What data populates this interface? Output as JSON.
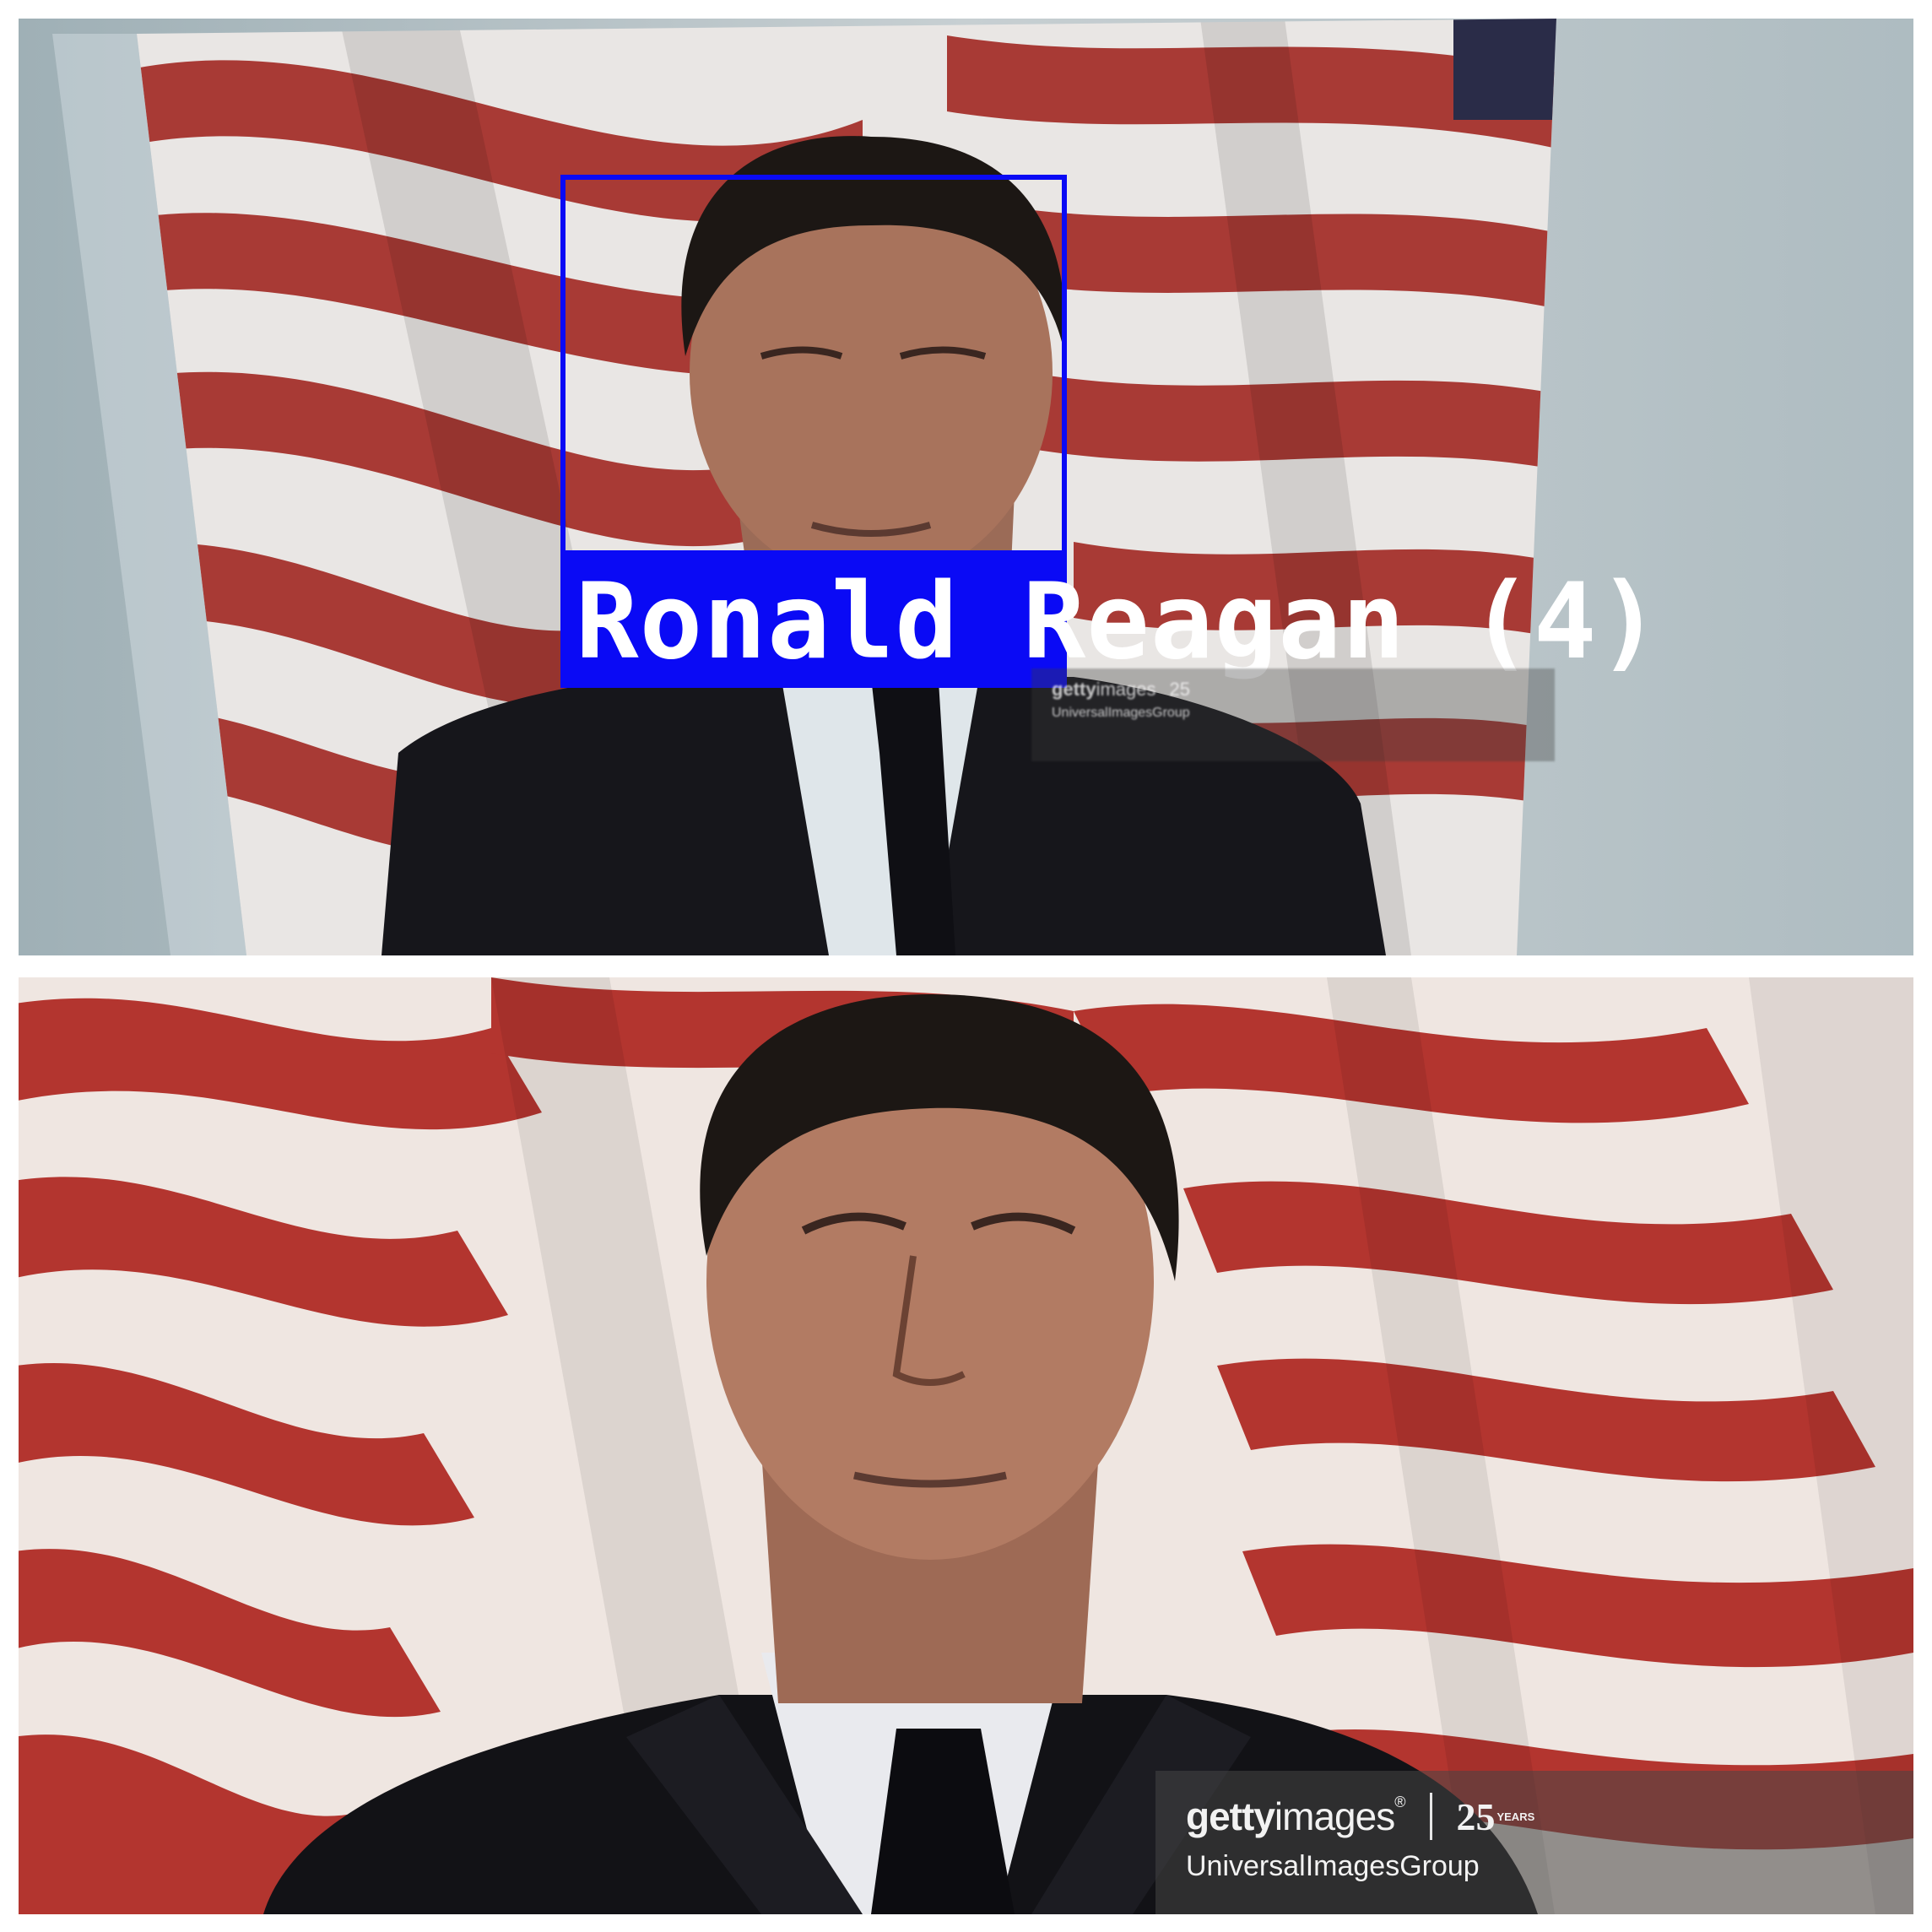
{
  "top_panel": {
    "detection_label": "Ronald Reagan (4)",
    "box_color": "#0a0af5",
    "watermark": {
      "brand_bold": "getty",
      "brand_light": "images",
      "years": "25",
      "credit": "UniversalImagesGroup"
    }
  },
  "bottom_panel": {
    "watermark": {
      "brand_bold": "getty",
      "brand_light": "images",
      "registered": "®",
      "years_number": "25",
      "years_word": "YEARS",
      "credit": "UniversalImagesGroup"
    }
  },
  "colors": {
    "flag_red": "#b3352f",
    "flag_white": "#eee7e2",
    "suit": "#15151a",
    "skin": "#b07a63",
    "hair": "#1c1714"
  }
}
